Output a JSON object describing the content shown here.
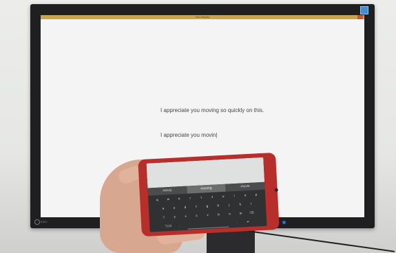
{
  "monitor": {
    "window_title": "Full Display",
    "brand": "EIZO",
    "line1": "I appreciate you moving so quickly on this.",
    "line2": "I appreciate you movin|"
  },
  "phone": {
    "suggestions": [
      "moviy",
      "moving",
      "movie"
    ],
    "keyboard": {
      "row1": [
        "q",
        "w",
        "e",
        "r",
        "t",
        "z",
        "u",
        "i",
        "o",
        "p"
      ],
      "row2": [
        "a",
        "s",
        "d",
        "f",
        "g",
        "h",
        "j",
        "k",
        "l"
      ],
      "row3": [
        "y",
        "x",
        "c",
        "v",
        "b",
        "n",
        "m"
      ],
      "row4_left": "?123",
      "row4_comma": ",",
      "row4_period": ".",
      "enter_icon": "return-arrow-icon"
    }
  }
}
